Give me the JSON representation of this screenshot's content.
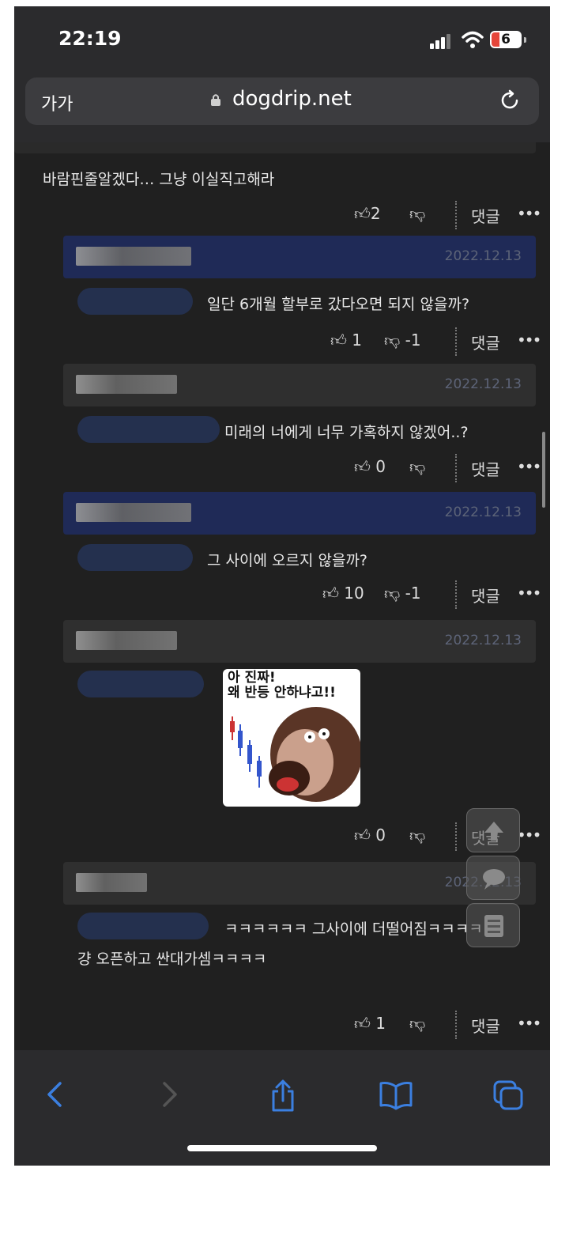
{
  "status_bar": {
    "time": "22:19",
    "battery": "6"
  },
  "url_bar": {
    "aa_label": "가가",
    "url": "dogdrip.net"
  },
  "comments": [
    {
      "text": "바람핀줄알겠다… 그냥 이실직고해라",
      "likes": "2",
      "dislikes": "",
      "reply_label": "댓글"
    },
    {
      "date": "2022.12.13",
      "text": "일단 6개월 할부로 갔다오면 되지 않을까?",
      "likes": "1",
      "dislikes": "-1",
      "reply_label": "댓글"
    },
    {
      "date": "2022.12.13",
      "text": "미래의 너에게 너무 가혹하지 않겠어..?",
      "likes": "0",
      "dislikes": "",
      "reply_label": "댓글"
    },
    {
      "date": "2022.12.13",
      "text": "그 사이에 오르지 않을까?",
      "likes": "10",
      "dislikes": "-1",
      "reply_label": "댓글"
    },
    {
      "date": "2022.12.13",
      "sticker_text": "아 진짜!\n왜 반등 안하냐고!!",
      "likes": "0",
      "dislikes": "",
      "reply_label": "댓글"
    },
    {
      "date": "2022.12.13",
      "text_line1": "ㅋㅋㅋㅋㅋㅋ 그사이에 더떨어짐ㅋㅋㅋㅋ",
      "text_line2": "걍 오픈하고 싼대가셈ㅋㅋㅋㅋ",
      "likes": "1",
      "dislikes": "",
      "reply_label": "댓글"
    }
  ],
  "colors": {
    "background": "#202020",
    "highlight_header": "#1f2a57",
    "toolbar_icon": "#3b7fe0",
    "battery_red": "#e5453a"
  }
}
